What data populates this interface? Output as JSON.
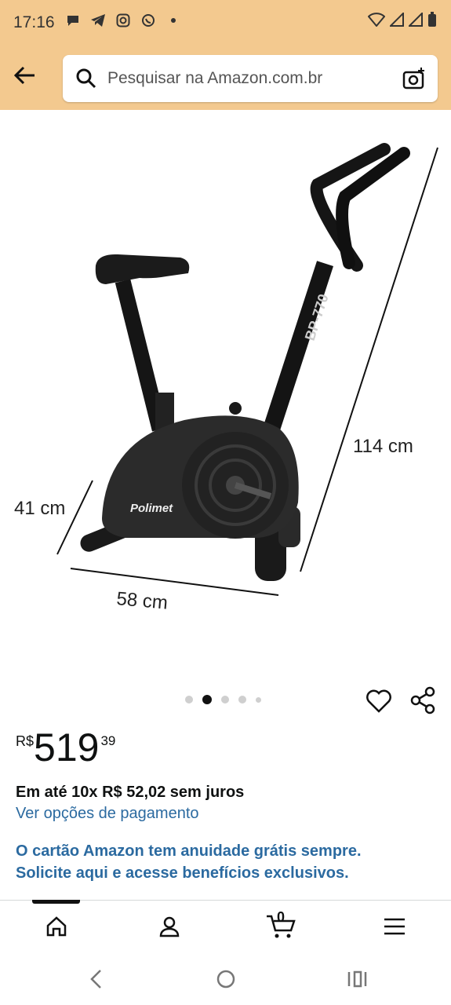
{
  "status": {
    "time": "17:16"
  },
  "search": {
    "placeholder": "Pesquisar na Amazon.com.br"
  },
  "product": {
    "image_labels": {
      "height": "114 cm",
      "depth": "41 cm",
      "width": "58 cm",
      "model": "BP-770",
      "brand": "Polimet"
    },
    "gallery": {
      "count": 5,
      "active_index": 1
    },
    "price": {
      "currency": "R$",
      "whole": "519",
      "fraction": "39"
    },
    "installments": "Em até 10x R$ 52,02 sem juros",
    "payment_link": "Ver opções de pagamento",
    "promo_line1": "O cartão Amazon tem anuidade grátis sempre.",
    "promo_line2": "Solicite aqui e acesse benefícios exclusivos."
  },
  "bottom_nav": {
    "cart_count": "0"
  },
  "icons": [
    "back-arrow-icon",
    "search-icon",
    "camera-icon",
    "heart-icon",
    "share-icon",
    "home-icon",
    "account-icon",
    "cart-icon",
    "menu-icon"
  ],
  "colors": {
    "header_bg": "#f3c98f",
    "link": "#2b6aa0"
  }
}
